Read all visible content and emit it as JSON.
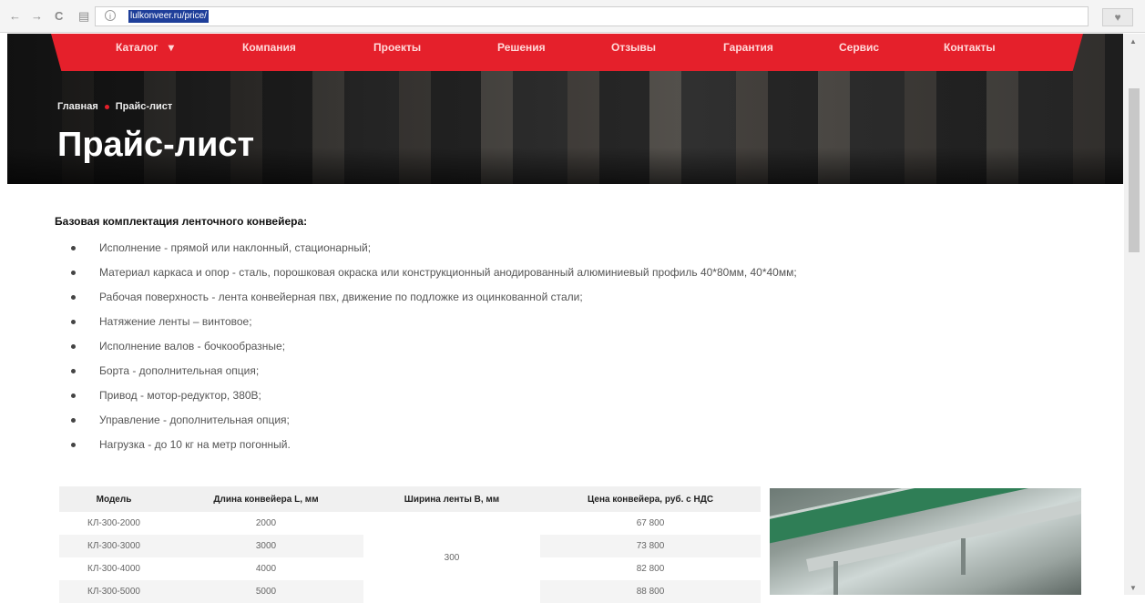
{
  "browser": {
    "back_glyph": "←",
    "forward_glyph": "→",
    "reload_glyph": "C",
    "reader_glyph": "▤",
    "info_glyph": "i",
    "url": "lulkonveer.ru/price/",
    "bookmark_glyph": "♥"
  },
  "nav": {
    "items": [
      {
        "label": "Каталог",
        "dropdown": true
      },
      {
        "label": "Компания"
      },
      {
        "label": "Проекты"
      },
      {
        "label": "Решения"
      },
      {
        "label": "Отзывы"
      },
      {
        "label": "Гарантия"
      },
      {
        "label": "Сервис"
      },
      {
        "label": "Контакты"
      }
    ],
    "dropdown_glyph": "▾"
  },
  "breadcrumb": {
    "home": "Главная",
    "current": "Прайс-лист"
  },
  "page_title": "Прайс-лист",
  "intro": "Базовая комплектация ленточного конвейера:",
  "features": [
    "Исполнение - прямой или наклонный, стационарный;",
    "Материал каркаса и опор - сталь, порошковая окраска или конструкционный анодированный алюминиевый профиль 40*80мм, 40*40мм;",
    "Рабочая поверхность - лента конвейерная пвх, движение по подложке из оцинкованной стали;",
    "Натяжение ленты – винтовое;",
    "Исполнение валов - бочкообразные;",
    "Борта - дополнительная опция;",
    "Привод - мотор-редуктор, 380В;",
    "Управление - дополнительная опция;",
    "Нагрузка - до 10 кг на метр погонный."
  ],
  "table": {
    "headers": [
      "Модель",
      "Длина конвейера L, мм",
      "Ширина ленты B, мм",
      "Цена конвейера, руб. с НДС"
    ],
    "width_value": "300",
    "rows": [
      {
        "model": "КЛ-300-2000",
        "length": "2000",
        "price": "67 800"
      },
      {
        "model": "КЛ-300-3000",
        "length": "3000",
        "price": "73 800"
      },
      {
        "model": "КЛ-300-4000",
        "length": "4000",
        "price": "82 800"
      },
      {
        "model": "КЛ-300-5000",
        "length": "5000",
        "price": "88 800"
      }
    ]
  },
  "colors": {
    "accent": "#e5202b",
    "hero_dark": "#2a2a2a"
  },
  "scrollbar": {
    "up_glyph": "▲",
    "down_glyph": "▼"
  }
}
